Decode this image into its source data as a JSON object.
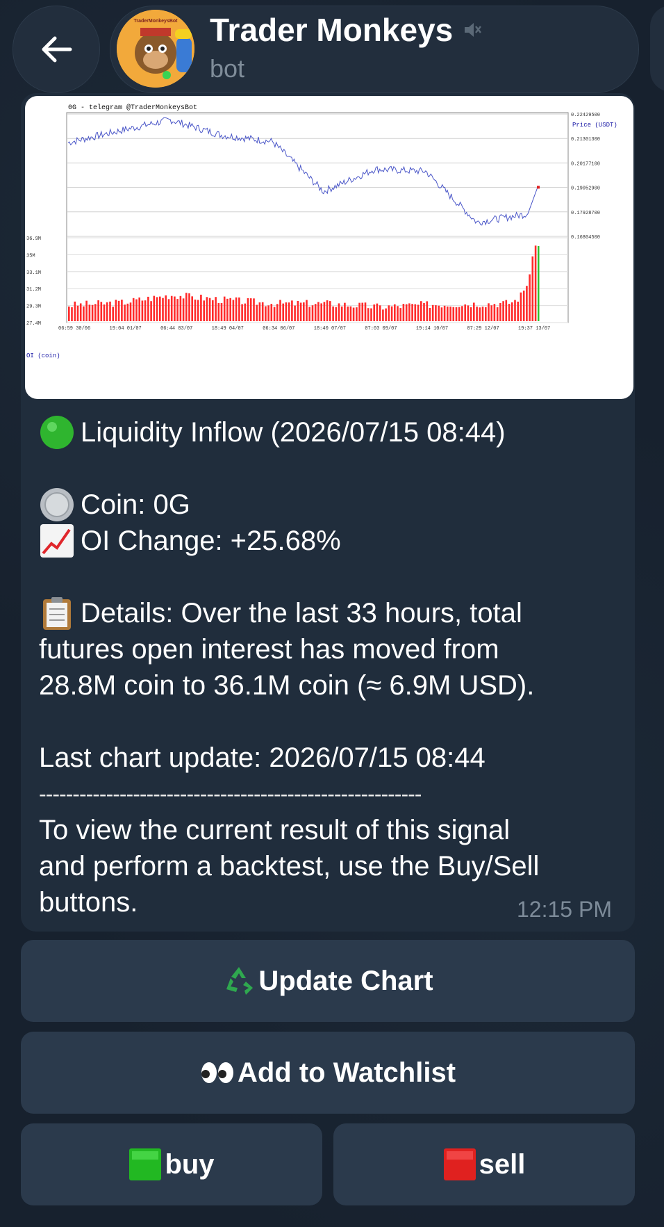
{
  "header": {
    "title": "Trader Monkeys",
    "subtitle": "bot",
    "avatar_text": "TraderMonkeysBot",
    "icons": {
      "back": "back-arrow-icon",
      "muted": "muted-speaker-icon"
    }
  },
  "chart_text": {
    "title": "0G - telegram @TraderMonkeysBot",
    "price_label": "Price (USDT)",
    "oi_label": "OI (coin)",
    "price_ticks": [
      "0.22429500",
      "0.21301300",
      "0.20177100",
      "0.19052900",
      "0.17928700",
      "0.16804500"
    ],
    "oi_ticks": [
      "36.9M",
      "35M",
      "33.1M",
      "31.2M",
      "29.3M",
      "27.4M"
    ],
    "x_ticks": [
      "06:59 30/06",
      "19:04 01/07",
      "06:44 03/07",
      "18:49 04/07",
      "06:34 06/07",
      "18:40 07/07",
      "07:03 09/07",
      "19:14 10/07",
      "07:29 12/07",
      "19:37 13/07"
    ]
  },
  "chart_data": {
    "type": "line",
    "title": "0G - telegram @TraderMonkeysBot",
    "xlabel": "",
    "ylabel": "Price (USDT)",
    "ylim": [
      0.168045,
      0.224295
    ],
    "x": [
      "06:59 30/06",
      "19:04 01/07",
      "06:44 03/07",
      "18:49 04/07",
      "06:34 06/07",
      "18:40 07/07",
      "07:03 09/07",
      "19:14 10/07",
      "07:29 12/07",
      "19:37 13/07"
    ],
    "series": [
      {
        "name": "Price (USDT)",
        "values": [
          0.2115,
          0.217,
          0.2222,
          0.215,
          0.212,
          0.1885,
          0.199,
          0.198,
          0.174,
          0.178
        ]
      },
      {
        "name": "OI (coin)",
        "values": [
          28.8,
          29.1,
          30.0,
          29.4,
          29.0,
          29.0,
          28.6,
          28.9,
          29.0,
          36.1
        ]
      }
    ],
    "secondary_ylim": [
      27.4,
      36.9
    ],
    "grid": true
  },
  "message": {
    "line1": "Liquidity Inflow (2026/07/15 08:44)",
    "coin": "Coin: 0G",
    "oi_change": "OI Change: +25.68%",
    "details_1": "Details: Over the last 33 hours, total",
    "details_2": "futures open interest has moved from",
    "details_3": "28.8M coin to 36.1M coin (≈ 6.9M USD).",
    "last_update": "Last chart update: 2026/07/15 08:44",
    "divider": "---------------------------------------------------------",
    "footer_1": "To view the current result of this signal",
    "footer_2": "and perform a backtest, use the Buy/Sell",
    "footer_3": "buttons.",
    "time": "12:15 PM"
  },
  "buttons": {
    "update_chart": "Update Chart",
    "watchlist": "Add to Watchlist",
    "buy": "buy",
    "sell": "sell"
  },
  "colors": {
    "accent_green": "#2fbf2f",
    "price_line": "#4a56c8",
    "oi_bar": "#ff2a2a"
  }
}
